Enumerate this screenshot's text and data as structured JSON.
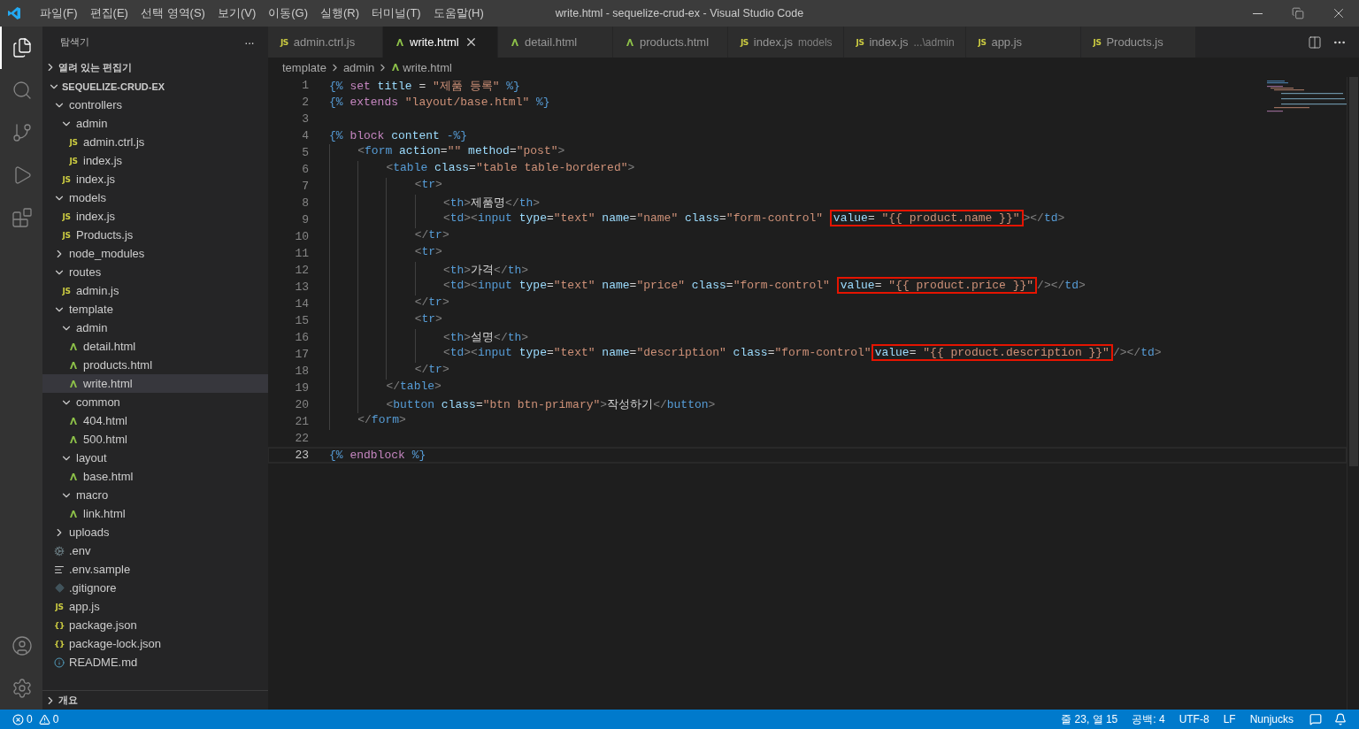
{
  "window": {
    "title": "write.html - sequelize-crud-ex - Visual Studio Code"
  },
  "menu": [
    "파일(F)",
    "편집(E)",
    "선택 영역(S)",
    "보기(V)",
    "이동(G)",
    "실행(R)",
    "터미널(T)",
    "도움말(H)"
  ],
  "activity_bar": {
    "items": [
      {
        "kind": "files",
        "selected": true
      },
      {
        "kind": "search",
        "selected": false
      },
      {
        "kind": "scm",
        "selected": false
      },
      {
        "kind": "debug",
        "selected": false
      },
      {
        "kind": "extensions",
        "selected": false
      }
    ],
    "bottom": [
      {
        "kind": "account"
      },
      {
        "kind": "settings"
      }
    ]
  },
  "sidebar": {
    "title": "탐색기",
    "more": "···",
    "sections": [
      {
        "label": "열려 있는 편집기",
        "expanded": false
      }
    ],
    "root": {
      "label": "SEQUELIZE-CRUD-EX",
      "expanded": true
    },
    "tree": [
      {
        "name": "controllers",
        "kind": "folder",
        "expanded": true,
        "children": [
          {
            "name": "admin",
            "kind": "folder",
            "expanded": true,
            "children": [
              {
                "name": "admin.ctrl.js",
                "kind": "js",
                "badge": "JS",
                "selected": false
              },
              {
                "name": "index.js",
                "kind": "js",
                "badge": "JS",
                "selected": false
              }
            ]
          },
          {
            "name": "index.js",
            "kind": "js",
            "badge": "JS",
            "selected": false
          }
        ]
      },
      {
        "name": "models",
        "kind": "folder",
        "expanded": true,
        "children": [
          {
            "name": "index.js",
            "kind": "js",
            "badge": "JS",
            "selected": false
          },
          {
            "name": "Products.js",
            "kind": "js",
            "badge": "JS",
            "selected": false
          }
        ]
      },
      {
        "name": "node_modules",
        "kind": "folder",
        "expanded": false
      },
      {
        "name": "routes",
        "kind": "folder",
        "expanded": true,
        "children": [
          {
            "name": "admin.js",
            "kind": "js",
            "badge": "JS",
            "selected": false
          }
        ]
      },
      {
        "name": "template",
        "kind": "folder",
        "expanded": true,
        "children": [
          {
            "name": "admin",
            "kind": "folder",
            "expanded": true,
            "children": [
              {
                "name": "detail.html",
                "kind": "html",
                "selected": false
              },
              {
                "name": "products.html",
                "kind": "html",
                "selected": false
              },
              {
                "name": "write.html",
                "kind": "html",
                "selected": true
              }
            ]
          },
          {
            "name": "common",
            "kind": "folder",
            "expanded": true,
            "children": [
              {
                "name": "404.html",
                "kind": "html",
                "selected": false
              },
              {
                "name": "500.html",
                "kind": "html",
                "selected": false
              }
            ]
          },
          {
            "name": "layout",
            "kind": "folder",
            "expanded": true,
            "children": [
              {
                "name": "base.html",
                "kind": "html",
                "selected": false
              }
            ]
          },
          {
            "name": "macro",
            "kind": "folder",
            "expanded": true,
            "children": [
              {
                "name": "link.html",
                "kind": "html",
                "selected": false
              }
            ]
          }
        ]
      },
      {
        "name": "uploads",
        "kind": "folder",
        "expanded": false
      },
      {
        "name": ".env",
        "kind": "env",
        "selected": false
      },
      {
        "name": ".env.sample",
        "kind": "text",
        "selected": false
      },
      {
        "name": ".gitignore",
        "kind": "git",
        "selected": false
      },
      {
        "name": "app.js",
        "kind": "js",
        "badge": "JS",
        "selected": false
      },
      {
        "name": "package.json",
        "kind": "json",
        "badge": "{}",
        "selected": false
      },
      {
        "name": "package-lock.json",
        "kind": "json",
        "badge": "{}",
        "selected": false
      },
      {
        "name": "README.md",
        "kind": "info",
        "selected": false
      }
    ],
    "bottom_sections": [
      {
        "label": "개요",
        "expanded": false
      }
    ]
  },
  "tabs": [
    {
      "label": "admin.ctrl.js",
      "kind": "js",
      "badge": "JS",
      "selected": false
    },
    {
      "label": "write.html",
      "kind": "html",
      "selected": true
    },
    {
      "label": "detail.html",
      "kind": "html",
      "selected": false
    },
    {
      "label": "products.html",
      "kind": "html",
      "selected": false
    },
    {
      "label": "index.js",
      "detail": "models",
      "kind": "js",
      "badge": "JS",
      "selected": false
    },
    {
      "label": "index.js",
      "detail": "...\\admin",
      "kind": "js",
      "badge": "JS",
      "selected": false
    },
    {
      "label": "app.js",
      "kind": "js",
      "badge": "JS",
      "selected": false
    },
    {
      "label": "Products.js",
      "kind": "js",
      "badge": "JS",
      "selected": false
    }
  ],
  "breadcrumb": [
    {
      "label": "template"
    },
    {
      "label": "admin"
    },
    {
      "label": "write.html",
      "kind": "html"
    }
  ],
  "editor": {
    "lines": [
      {
        "n": "1",
        "tokens": [
          {
            "kind": "delim",
            "text": "{% "
          },
          {
            "kind": "kw",
            "text": "set"
          },
          {
            "kind": "var",
            "text": " title"
          },
          {
            "kind": "op",
            "text": " = "
          },
          {
            "kind": "str",
            "text": "\"제품 등록\""
          },
          {
            "kind": "delim",
            "text": " %}"
          }
        ]
      },
      {
        "n": "2",
        "tokens": [
          {
            "kind": "delim",
            "text": "{% "
          },
          {
            "kind": "kw",
            "text": "extends"
          },
          {
            "kind": "str",
            "text": " \"layout/base.html\""
          },
          {
            "kind": "delim",
            "text": " %}"
          }
        ]
      },
      {
        "n": "3"
      },
      {
        "n": "4",
        "tokens": [
          {
            "kind": "delim",
            "text": "{% "
          },
          {
            "kind": "kw",
            "text": "block"
          },
          {
            "kind": "var",
            "text": " content"
          },
          {
            "kind": "delim",
            "text": " -%}"
          }
        ]
      },
      {
        "n": "5",
        "tokens": [
          {
            "kind": "punct",
            "text": "    <"
          },
          {
            "kind": "tag",
            "text": "form"
          },
          {
            "kind": "attr",
            "text": " action"
          },
          {
            "kind": "op",
            "text": "="
          },
          {
            "kind": "str",
            "text": "\"\""
          },
          {
            "kind": "attr",
            "text": " method"
          },
          {
            "kind": "op",
            "text": "="
          },
          {
            "kind": "str",
            "text": "\"post\""
          },
          {
            "kind": "punct",
            "text": ">"
          }
        ]
      },
      {
        "n": "6",
        "tokens": [
          {
            "kind": "punct",
            "text": "        <"
          },
          {
            "kind": "tag",
            "text": "table"
          },
          {
            "kind": "attr",
            "text": " class"
          },
          {
            "kind": "op",
            "text": "="
          },
          {
            "kind": "str",
            "text": "\"table table-bordered\""
          },
          {
            "kind": "punct",
            "text": ">"
          }
        ]
      },
      {
        "n": "7",
        "tokens": [
          {
            "kind": "punct",
            "text": "            <"
          },
          {
            "kind": "tag",
            "text": "tr"
          },
          {
            "kind": "punct",
            "text": ">"
          }
        ]
      },
      {
        "n": "8",
        "tokens": [
          {
            "kind": "punct",
            "text": "                <"
          },
          {
            "kind": "tag",
            "text": "th"
          },
          {
            "kind": "punct",
            "text": ">"
          },
          {
            "kind": "plain",
            "text": "제품명"
          },
          {
            "kind": "punct",
            "text": "</"
          },
          {
            "kind": "tag",
            "text": "th"
          },
          {
            "kind": "punct",
            "text": ">"
          }
        ]
      },
      {
        "n": "9",
        "tokens": [
          {
            "kind": "punct",
            "text": "                <"
          },
          {
            "kind": "tag",
            "text": "td"
          },
          {
            "kind": "punct",
            "text": "><"
          },
          {
            "kind": "tag",
            "text": "input"
          },
          {
            "kind": "attr",
            "text": " type"
          },
          {
            "kind": "op",
            "text": "="
          },
          {
            "kind": "str",
            "text": "\"text\""
          },
          {
            "kind": "attr",
            "text": " name"
          },
          {
            "kind": "op",
            "text": "="
          },
          {
            "kind": "str",
            "text": "\"name\""
          },
          {
            "kind": "attr",
            "text": " class"
          },
          {
            "kind": "op",
            "text": "="
          },
          {
            "kind": "str",
            "text": "\"form-control\" "
          },
          {
            "kind": "boxed",
            "tokens": [
              {
                "kind": "attr",
                "text": "value"
              },
              {
                "kind": "op",
                "text": "= "
              },
              {
                "kind": "str",
                "text": "\"{{ product.name }}\""
              }
            ]
          },
          {
            "kind": "punct",
            "text": "></"
          },
          {
            "kind": "tag",
            "text": "td"
          },
          {
            "kind": "punct",
            "text": ">"
          }
        ]
      },
      {
        "n": "10",
        "tokens": [
          {
            "kind": "punct",
            "text": "            </"
          },
          {
            "kind": "tag",
            "text": "tr"
          },
          {
            "kind": "punct",
            "text": ">"
          }
        ]
      },
      {
        "n": "11",
        "tokens": [
          {
            "kind": "punct",
            "text": "            <"
          },
          {
            "kind": "tag",
            "text": "tr"
          },
          {
            "kind": "punct",
            "text": ">"
          }
        ]
      },
      {
        "n": "12",
        "tokens": [
          {
            "kind": "punct",
            "text": "                <"
          },
          {
            "kind": "tag",
            "text": "th"
          },
          {
            "kind": "punct",
            "text": ">"
          },
          {
            "kind": "plain",
            "text": "가격"
          },
          {
            "kind": "punct",
            "text": "</"
          },
          {
            "kind": "tag",
            "text": "th"
          },
          {
            "kind": "punct",
            "text": ">"
          }
        ]
      },
      {
        "n": "13",
        "tokens": [
          {
            "kind": "punct",
            "text": "                <"
          },
          {
            "kind": "tag",
            "text": "td"
          },
          {
            "kind": "punct",
            "text": "><"
          },
          {
            "kind": "tag",
            "text": "input"
          },
          {
            "kind": "attr",
            "text": " type"
          },
          {
            "kind": "op",
            "text": "="
          },
          {
            "kind": "str",
            "text": "\"text\""
          },
          {
            "kind": "attr",
            "text": " name"
          },
          {
            "kind": "op",
            "text": "="
          },
          {
            "kind": "str",
            "text": "\"price\""
          },
          {
            "kind": "attr",
            "text": " class"
          },
          {
            "kind": "op",
            "text": "="
          },
          {
            "kind": "str",
            "text": "\"form-control\" "
          },
          {
            "kind": "boxed",
            "tokens": [
              {
                "kind": "attr",
                "text": "value"
              },
              {
                "kind": "op",
                "text": "= "
              },
              {
                "kind": "str",
                "text": "\"{{ product.price }}\""
              }
            ]
          },
          {
            "kind": "punct",
            "text": "/></"
          },
          {
            "kind": "tag",
            "text": "td"
          },
          {
            "kind": "punct",
            "text": ">"
          }
        ]
      },
      {
        "n": "14",
        "tokens": [
          {
            "kind": "punct",
            "text": "            </"
          },
          {
            "kind": "tag",
            "text": "tr"
          },
          {
            "kind": "punct",
            "text": ">"
          }
        ]
      },
      {
        "n": "15",
        "tokens": [
          {
            "kind": "punct",
            "text": "            <"
          },
          {
            "kind": "tag",
            "text": "tr"
          },
          {
            "kind": "punct",
            "text": ">"
          }
        ]
      },
      {
        "n": "16",
        "tokens": [
          {
            "kind": "punct",
            "text": "                <"
          },
          {
            "kind": "tag",
            "text": "th"
          },
          {
            "kind": "punct",
            "text": ">"
          },
          {
            "kind": "plain",
            "text": "설명"
          },
          {
            "kind": "punct",
            "text": "</"
          },
          {
            "kind": "tag",
            "text": "th"
          },
          {
            "kind": "punct",
            "text": ">"
          }
        ]
      },
      {
        "n": "17",
        "tokens": [
          {
            "kind": "punct",
            "text": "                <"
          },
          {
            "kind": "tag",
            "text": "td"
          },
          {
            "kind": "punct",
            "text": "><"
          },
          {
            "kind": "tag",
            "text": "input"
          },
          {
            "kind": "attr",
            "text": " type"
          },
          {
            "kind": "op",
            "text": "="
          },
          {
            "kind": "str",
            "text": "\"text\""
          },
          {
            "kind": "attr",
            "text": " name"
          },
          {
            "kind": "op",
            "text": "="
          },
          {
            "kind": "str",
            "text": "\"description\""
          },
          {
            "kind": "attr",
            "text": " class"
          },
          {
            "kind": "op",
            "text": "="
          },
          {
            "kind": "str",
            "text": "\"form-control\""
          },
          {
            "kind": "boxed",
            "tokens": [
              {
                "kind": "attr",
                "text": "value"
              },
              {
                "kind": "op",
                "text": "= "
              },
              {
                "kind": "str",
                "text": "\"{{ product.description }}\""
              }
            ]
          },
          {
            "kind": "punct",
            "text": "/></"
          },
          {
            "kind": "tag",
            "text": "td"
          },
          {
            "kind": "punct",
            "text": ">"
          }
        ]
      },
      {
        "n": "18",
        "tokens": [
          {
            "kind": "punct",
            "text": "            </"
          },
          {
            "kind": "tag",
            "text": "tr"
          },
          {
            "kind": "punct",
            "text": ">"
          }
        ]
      },
      {
        "n": "19",
        "tokens": [
          {
            "kind": "punct",
            "text": "        </"
          },
          {
            "kind": "tag",
            "text": "table"
          },
          {
            "kind": "punct",
            "text": ">"
          }
        ]
      },
      {
        "n": "20",
        "tokens": [
          {
            "kind": "punct",
            "text": "        <"
          },
          {
            "kind": "tag",
            "text": "button"
          },
          {
            "kind": "attr",
            "text": " class"
          },
          {
            "kind": "op",
            "text": "="
          },
          {
            "kind": "str",
            "text": "\"btn btn-primary\""
          },
          {
            "kind": "punct",
            "text": ">"
          },
          {
            "kind": "plain",
            "text": "작성하기"
          },
          {
            "kind": "punct",
            "text": "</"
          },
          {
            "kind": "tag",
            "text": "button"
          },
          {
            "kind": "punct",
            "text": ">"
          }
        ]
      },
      {
        "n": "21",
        "tokens": [
          {
            "kind": "punct",
            "text": "    </"
          },
          {
            "kind": "tag",
            "text": "form"
          },
          {
            "kind": "punct",
            "text": ">"
          }
        ]
      },
      {
        "n": "22"
      },
      {
        "n": "23",
        "current": true,
        "tokens": [
          {
            "kind": "delim",
            "text": "{% "
          },
          {
            "kind": "kw",
            "text": "endblock"
          },
          {
            "kind": "delim",
            "text": " %}"
          }
        ]
      }
    ]
  },
  "status_bar": {
    "errors": "0",
    "warnings": "0",
    "right": [
      "줄 23, 열 15",
      "공백: 4",
      "UTF-8",
      "LF",
      "Nunjucks"
    ]
  }
}
